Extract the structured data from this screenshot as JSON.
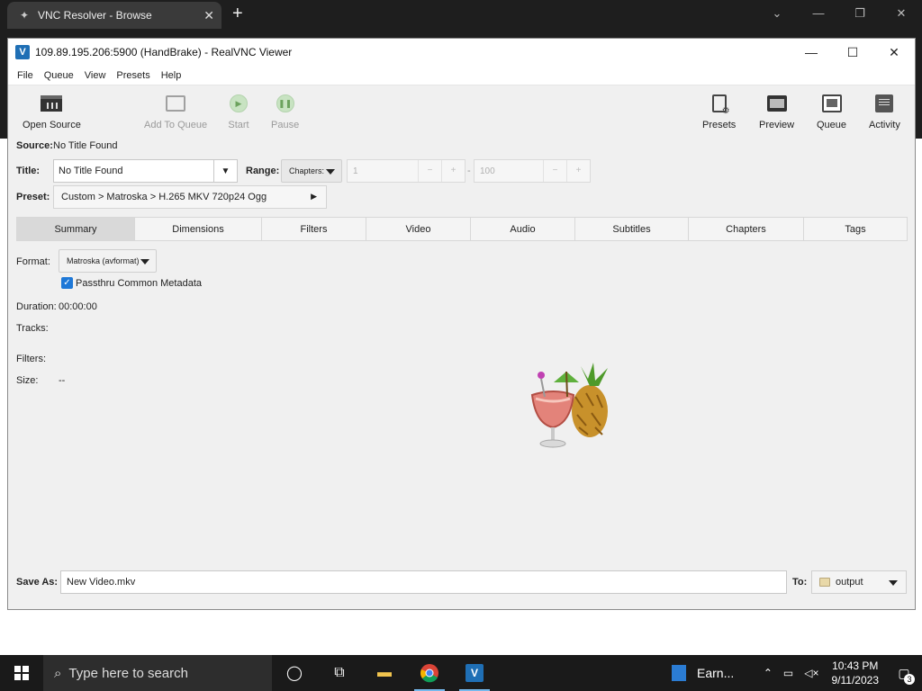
{
  "browser": {
    "tab_title": "VNC Resolver - Browse",
    "new_tab_symbol": "+",
    "close_symbol": "✕",
    "controls": [
      "⌄",
      "—",
      "❐",
      "✕"
    ]
  },
  "vnc": {
    "title": "109.89.195.206:5900 (HandBrake) - RealVNC Viewer",
    "controls": [
      "—",
      "☐",
      "✕"
    ]
  },
  "menu": [
    "File",
    "Queue",
    "View",
    "Presets",
    "Help"
  ],
  "toolbar": {
    "open_source": "Open Source",
    "add_to_queue": "Add To Queue",
    "start": "Start",
    "pause": "Pause",
    "presets": "Presets",
    "preview": "Preview",
    "queue": "Queue",
    "activity": "Activity"
  },
  "source": {
    "label": "Source:",
    "value": "No Title Found"
  },
  "title": {
    "label": "Title:",
    "value": "No Title Found"
  },
  "range": {
    "label": "Range:",
    "mode": "Chapters:",
    "start": "1",
    "end": "100",
    "minus": "−",
    "plus": "+",
    "dash": "-"
  },
  "preset": {
    "label": "Preset:",
    "value": "Custom > Matroska > H.265 MKV 720p24 Ogg"
  },
  "tabs": [
    "Summary",
    "Dimensions",
    "Filters",
    "Video",
    "Audio",
    "Subtitles",
    "Chapters",
    "Tags"
  ],
  "active_tab": "Summary",
  "summary": {
    "format_label": "Format:",
    "format_value": "Matroska (avformat)",
    "passthru_label": "Passthru Common Metadata",
    "passthru_checked": true,
    "duration_label": "Duration:",
    "duration_value": "00:00:00",
    "tracks_label": "Tracks:",
    "filters_label": "Filters:",
    "size_label": "Size:",
    "size_value": "--"
  },
  "save": {
    "label": "Save As:",
    "value": "New Video.mkv",
    "to_label": "To:",
    "folder": "output"
  },
  "taskbar": {
    "search_placeholder": "Type here to search",
    "pinned_app": "Earn...",
    "time": "10:43 PM",
    "date": "9/11/2023",
    "notification_count": "3"
  },
  "colors": {
    "accent": "#1e78d7",
    "vnc_logo": "#1f6fb5",
    "taskbar": "#1a1a1a"
  }
}
